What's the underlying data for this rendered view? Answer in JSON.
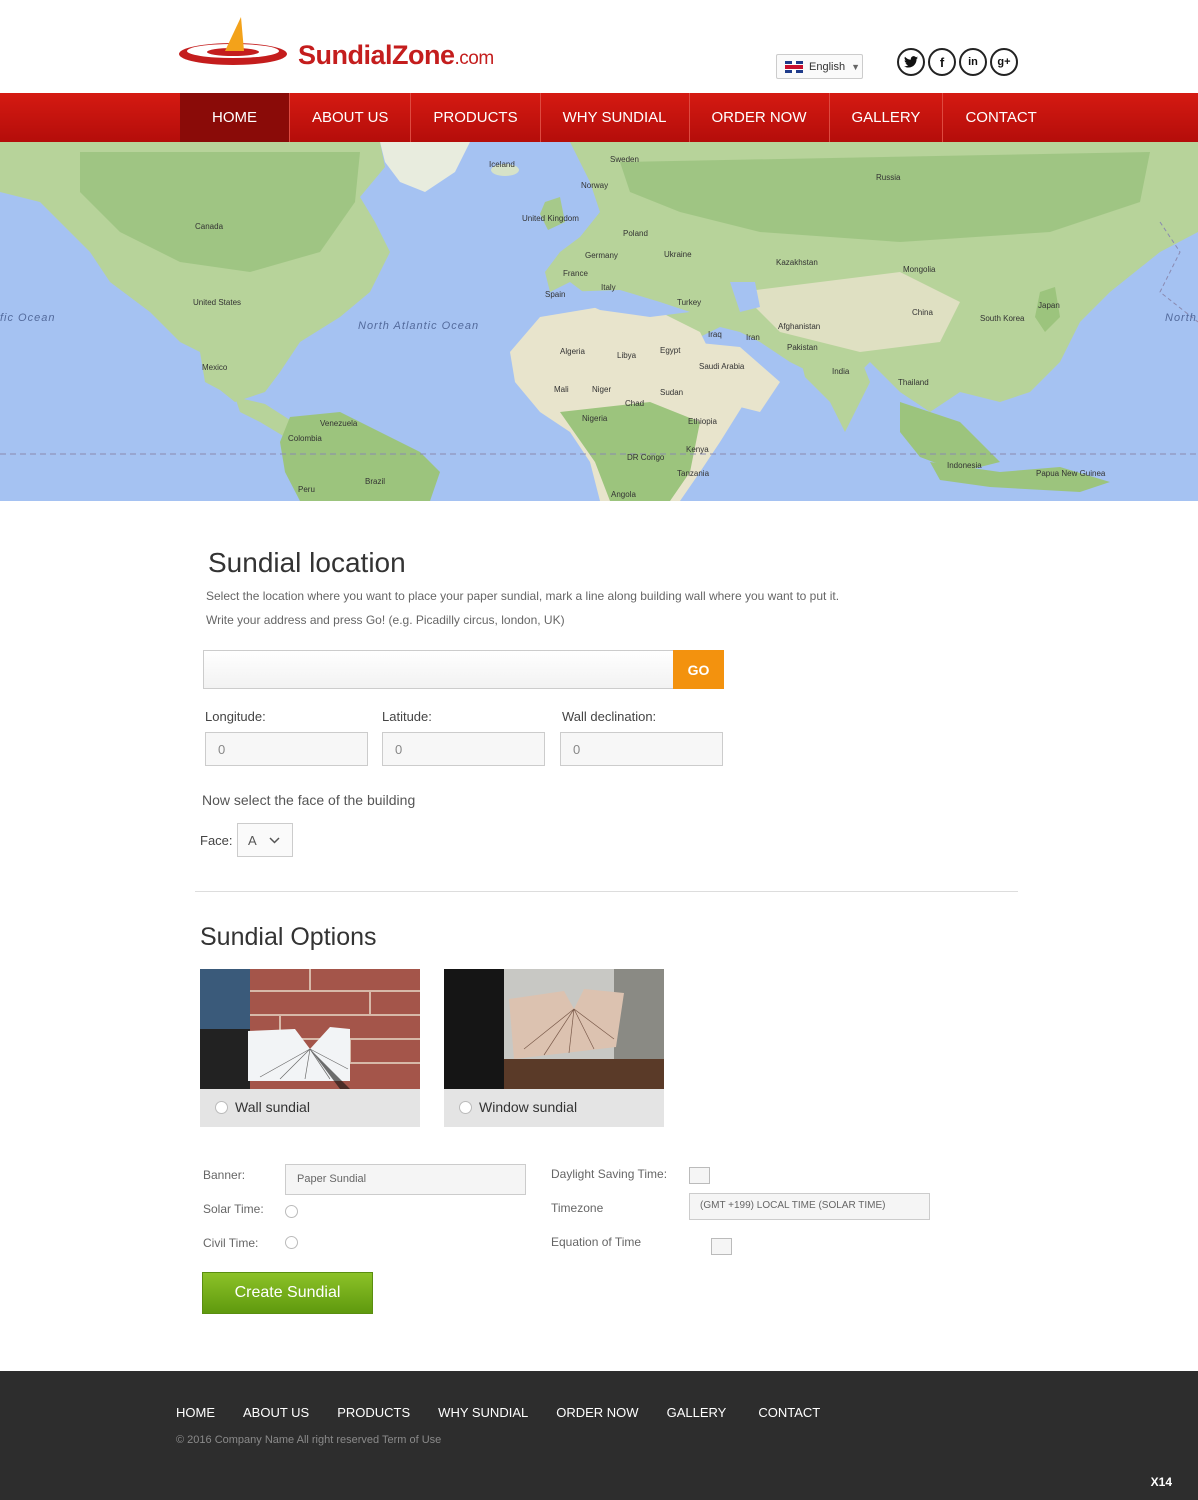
{
  "brand": {
    "name": "SundialZone",
    "suffix": ".com"
  },
  "language": {
    "selected": "English"
  },
  "social": [
    {
      "icon": "twitter-icon",
      "glyph": "t"
    },
    {
      "icon": "facebook-icon",
      "glyph": "f"
    },
    {
      "icon": "linkedin-icon",
      "glyph": "in"
    },
    {
      "icon": "google-plus-icon",
      "glyph": "g+"
    }
  ],
  "nav": {
    "home": "HOME",
    "about": "ABOUT US",
    "products": "PRODUCTS",
    "why": "WHY SUNDIAL",
    "order": "ORDER NOW",
    "gallery": "GALLERY",
    "contact": "CONTACT"
  },
  "map": {
    "labels": {
      "iceland": "Iceland",
      "sweden": "Sweden",
      "norway": "Norway",
      "russia": "Russia",
      "canada": "Canada",
      "uk": "United Kingdom",
      "poland": "Poland",
      "germany": "Germany",
      "ukraine": "Ukraine",
      "kazakhstan": "Kazakhstan",
      "mongolia": "Mongolia",
      "france": "France",
      "italy": "Italy",
      "spain": "Spain",
      "turkey": "Turkey",
      "japan": "Japan",
      "china": "China",
      "south_korea": "South Korea",
      "us": "United States",
      "pacific": "fic Ocean",
      "atlantic": "North Atlantic Ocean",
      "north": "North",
      "afghanistan": "Afghanistan",
      "iraq": "Iraq",
      "iran": "Iran",
      "pakistan": "Pakistan",
      "algeria": "Algeria",
      "libya": "Libya",
      "egypt": "Egypt",
      "saudi": "Saudi Arabia",
      "india": "India",
      "mexico": "Mexico",
      "thailand": "Thailand",
      "mali": "Mali",
      "niger": "Niger",
      "sudan": "Sudan",
      "chad": "Chad",
      "nigeria": "Nigeria",
      "ethiopia": "Ethiopia",
      "venezuela": "Venezuela",
      "colombia": "Colombia",
      "kenya": "Kenya",
      "drc": "DR Congo",
      "indonesia": "Indonesia",
      "tanzania": "Tanzania",
      "png": "Papua New Guinea",
      "brazil": "Brazil",
      "peru": "Peru",
      "angola": "Angola"
    }
  },
  "location": {
    "title": "Sundial location",
    "desc1": "Select the location where you want to place your paper sundial, mark a line along building wall where you want to put it.",
    "desc2": "Write your address and press Go! (e.g. Picadilly circus, london, UK)",
    "address_value": "",
    "go_label": "GO",
    "longitude_label": "Longitude:",
    "longitude_value": "0",
    "latitude_label": "Latitude:",
    "latitude_value": "0",
    "wall_label": "Wall declination:",
    "wall_value": "0",
    "face_prompt": "Now select the face of the building",
    "face_label": "Face:",
    "face_value": "A"
  },
  "options": {
    "title": "Sundial Options",
    "wall_label": "Wall sundial",
    "window_label": "Window sundial",
    "banner_label": "Banner:",
    "banner_value": "Paper Sundial",
    "solar_label": "Solar Time:",
    "civil_label": "Civil Time:",
    "dst_label": "Daylight Saving Time:",
    "timezone_label": "Timezone",
    "timezone_value": "(GMT +199) LOCAL TIME (SOLAR TIME)",
    "eot_label": "Equation of Time",
    "create_label": "Create Sundial"
  },
  "footer": {
    "copyright": "© 2016 Company Name  All right reserved  Term of Use",
    "badge": "X14"
  },
  "colors": {
    "brand_red": "#c41d1d",
    "go_orange": "#f3920e",
    "create_green": "#7ab51d",
    "footer_bg": "#2d2d2d"
  }
}
